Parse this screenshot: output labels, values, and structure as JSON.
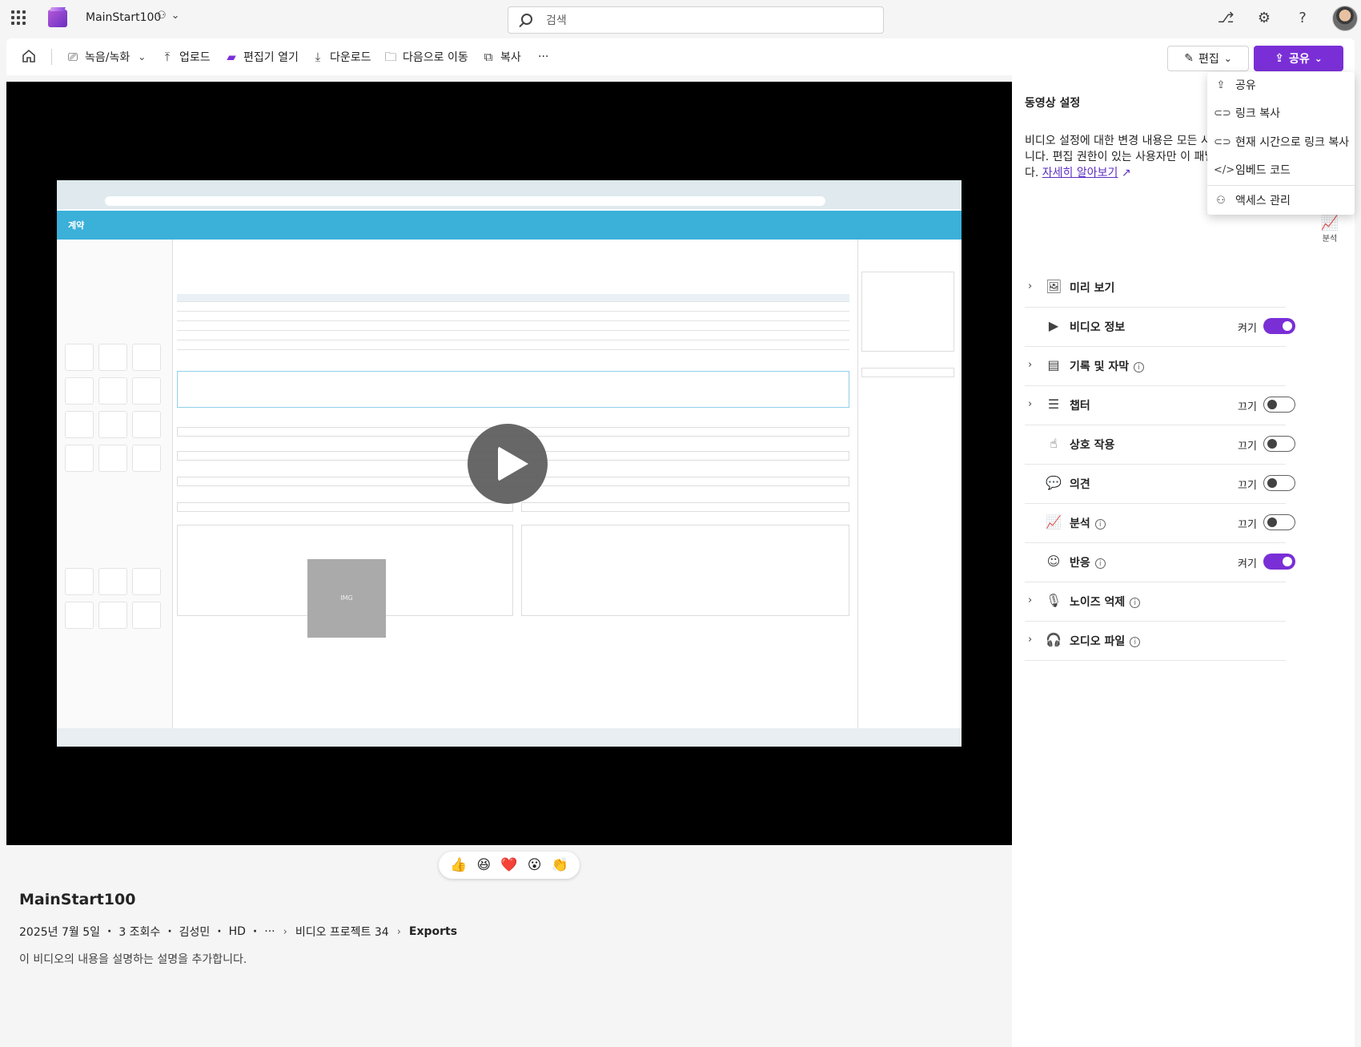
{
  "app": {
    "title": "MainStart100",
    "search_placeholder": "검색"
  },
  "commands": {
    "record": "녹음/녹화",
    "upload": "업로드",
    "open_editor": "편집기 열기",
    "download": "다운로드",
    "move_to": "다음으로 이동",
    "copy": "복사",
    "more": "···",
    "edit": "편집",
    "share": "공유"
  },
  "share_menu": {
    "items": [
      "공유",
      "링크 복사",
      "현재 시간으로 링크 복사",
      "임베드 코드",
      "액세스 관리"
    ]
  },
  "settings": {
    "title": "동영상 설정",
    "desc_lines": [
      "비디오 설정에 대한 변경 내용은 모든 시",
      "니다. 편집 권한이 있는 사용자만 이 패널",
      "다."
    ],
    "learn_more": "자세히 알아보기",
    "rows": [
      {
        "label": "미리 보기",
        "state": "",
        "toggle": "none",
        "expandable": true,
        "info": false,
        "icon": "🖼"
      },
      {
        "label": "비디오 정보",
        "state": "켜기",
        "toggle": "on",
        "expandable": false,
        "info": false,
        "icon": "▶"
      },
      {
        "label": "기록 및 자막",
        "state": "",
        "toggle": "none",
        "expandable": true,
        "info": true,
        "icon": "▤"
      },
      {
        "label": "챕터",
        "state": "끄기",
        "toggle": "off",
        "expandable": true,
        "info": false,
        "icon": "☰"
      },
      {
        "label": "상호 작용",
        "state": "끄기",
        "toggle": "off",
        "expandable": false,
        "info": false,
        "icon": "☝"
      },
      {
        "label": "의견",
        "state": "끄기",
        "toggle": "off",
        "expandable": false,
        "info": false,
        "icon": "💬"
      },
      {
        "label": "분석",
        "state": "끄기",
        "toggle": "off",
        "expandable": false,
        "info": true,
        "icon": "📈"
      },
      {
        "label": "반응",
        "state": "켜기",
        "toggle": "on",
        "expandable": false,
        "info": true,
        "icon": "☺"
      },
      {
        "label": "노이즈 억제",
        "state": "",
        "toggle": "none",
        "expandable": true,
        "info": true,
        "icon": "🎙"
      },
      {
        "label": "오디오 파일",
        "state": "",
        "toggle": "none",
        "expandable": true,
        "info": true,
        "icon": "🎧"
      }
    ],
    "analytics_rail_label": "분석"
  },
  "reactions": [
    "👍",
    "😆",
    "❤️",
    "😮",
    "👏"
  ],
  "video": {
    "title": "MainStart100",
    "date": "2025년 7월 5일",
    "views": "3 조회수",
    "author": "김성민",
    "quality": "HD",
    "more": "···",
    "breadcrumb_folder": "비디오 프로젝트 34",
    "breadcrumb_current": "Exports",
    "description": "이 비디오의 내용을 설명하는 설명을 추가합니다."
  },
  "screen": {
    "app_header": "계약",
    "image_placeholder": "IMG"
  },
  "colors": {
    "accent": "#7a2fd6",
    "screen_header": "#3bb0d9"
  }
}
